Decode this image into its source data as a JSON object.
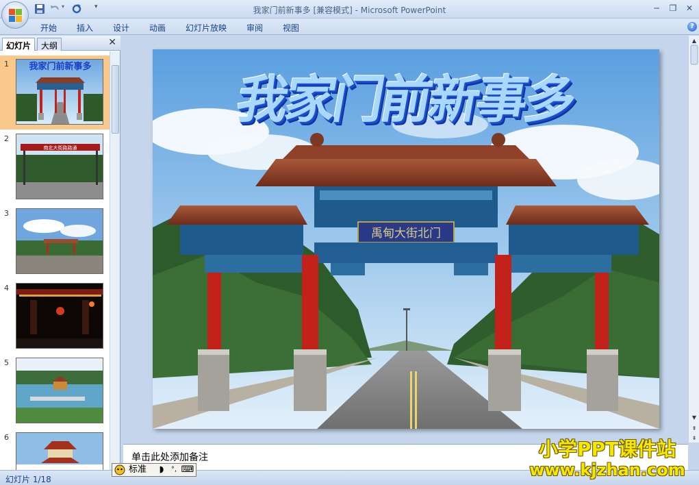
{
  "window": {
    "title": "我家门前新事多 [兼容模式] - Microsoft PowerPoint"
  },
  "ribbon": {
    "tabs": [
      {
        "label": "开始"
      },
      {
        "label": "插入"
      },
      {
        "label": "设计"
      },
      {
        "label": "动画"
      },
      {
        "label": "幻灯片放映"
      },
      {
        "label": "审阅"
      },
      {
        "label": "视图"
      }
    ]
  },
  "left_pane": {
    "tab_slides": "幻灯片",
    "tab_outline": "大纲",
    "thumbnails": [
      {
        "number": "1",
        "caption": "我家门前新事多",
        "selected": true
      },
      {
        "number": "2",
        "caption": "南北大街路路通",
        "selected": false
      },
      {
        "number": "3",
        "caption": "",
        "selected": false
      },
      {
        "number": "4",
        "caption": "",
        "selected": false
      },
      {
        "number": "5",
        "caption": "",
        "selected": false
      },
      {
        "number": "6",
        "caption": "",
        "selected": false
      }
    ]
  },
  "slide": {
    "title": "我家门前新事多",
    "gate_plaque": "禹甸大街北门"
  },
  "notes": {
    "placeholder": "单击此处添加备注"
  },
  "status": {
    "slide_counter": "幻灯片 1/18"
  },
  "ime": {
    "mode_label": "标准"
  },
  "watermark": {
    "line1": "小学PPT课件站",
    "line2": "www.kjzhan.com"
  }
}
